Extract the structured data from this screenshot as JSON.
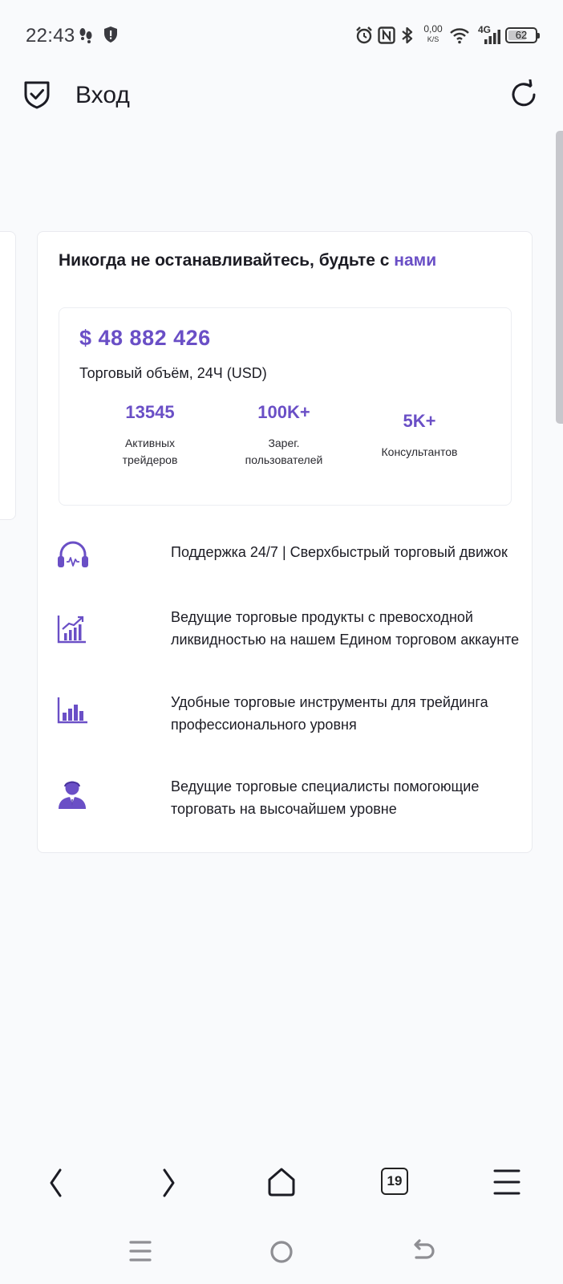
{
  "status_bar": {
    "time": "22:43",
    "net_speed_value": "0,00",
    "net_speed_unit": "K/S",
    "network": "4G",
    "battery_percent": "62",
    "battery_level": 0.62,
    "icons": [
      "footsteps-icon",
      "shield-icon",
      "alarm-icon",
      "nfc-icon",
      "bluetooth-icon",
      "wifi-icon",
      "signal-icon",
      "battery-icon"
    ]
  },
  "header": {
    "title": "Вход",
    "icons": [
      "shield-check-icon",
      "refresh-icon"
    ]
  },
  "card": {
    "title_main": "Никогда не останавливайтесь, будьте с ",
    "title_accent": "нами",
    "accent_color": "#6a4fc6",
    "volume": {
      "value": "$ 48 882 426",
      "label": "Торговый объём, 24Ч (USD)"
    },
    "stats": [
      {
        "value": "13545",
        "label_line1": "Активных",
        "label_line2": "трейдеров"
      },
      {
        "value": "100K+",
        "label_line1": "Зарег.",
        "label_line2": "пользователей"
      },
      {
        "value": "5K+",
        "label_line1": "Консультантов",
        "label_line2": ""
      }
    ],
    "features": [
      {
        "icon": "headphones-icon",
        "line1": "Поддержка 24/7 | Сверхбыстрый торговый движок",
        "line2": ""
      },
      {
        "icon": "growth-chart-icon",
        "line1": "Ведущие торговые продукты с превосходной",
        "line2": "ликвидностью на нашем Едином торговом аккаунте"
      },
      {
        "icon": "bar-chart-icon",
        "line1": "Удобные торговые инструменты для трейдинга",
        "line2": "профессионального уровня"
      },
      {
        "icon": "specialist-icon",
        "line1": "Ведущие торговые специалисты помогоющие",
        "line2": "торговать на высочайшем уровне"
      }
    ]
  },
  "browser_nav": {
    "tab_count": "19",
    "icons": [
      "back-icon",
      "forward-icon",
      "home-icon",
      "tabs-icon",
      "menu-icon"
    ]
  },
  "system_nav": {
    "icons": [
      "recent-apps-icon",
      "home-circle-icon",
      "back-arrow-icon"
    ]
  }
}
